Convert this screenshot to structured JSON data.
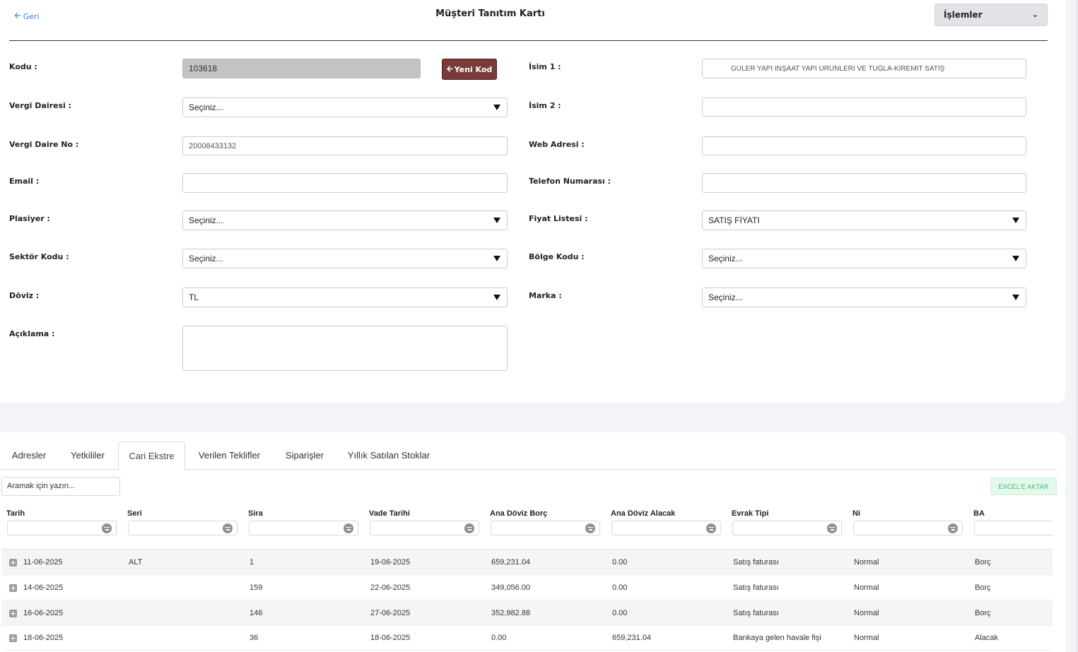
{
  "header": {
    "back_label": "Geri",
    "title": "Müşteri Tanıtım Kartı",
    "actions_label": "İşlemler"
  },
  "form": {
    "code_label": "Kodu :",
    "code_value": "103618",
    "new_code_label": "Yeni Kod",
    "tax_office_label": "Vergi Dairesi :",
    "tax_office_value": "Seçiniz...",
    "tax_no_label": "Vergi Daire No :",
    "tax_no_value": "20008433132",
    "email_label": "Email :",
    "email_value": "",
    "salesperson_label": "Plasiyer :",
    "salesperson_value": "Seçiniz...",
    "sector_label": "Sektör Kodu :",
    "sector_value": "Seçiniz...",
    "currency_label": "Döviz :",
    "currency_value": "TL",
    "description_label": "Açıklama :",
    "name1_label": "İsim 1 :",
    "name1_value": "GÜLER YAPI İNŞAAT YAPI ÜRÜNLERİ VE TUĞLA-KİREMİT SATIŞ",
    "name2_label": "İsim 2 :",
    "name2_value": "",
    "web_label": "Web Adresi :",
    "web_value": "",
    "phone_label": "Telefon Numarası :",
    "phone_value": "",
    "price_list_label": "Fiyat Listesi :",
    "price_list_value": "SATIŞ FİYATI",
    "region_label": "Bölge Kodu :",
    "region_value": "Seçiniz...",
    "brand_label": "Marka :",
    "brand_value": "Seçiniz..."
  },
  "tabs": [
    "Adresler",
    "Yetkililer",
    "Cari Ekstre",
    "Verilen Teklifler",
    "Siparişler",
    "Yıllık Satılan Stoklar"
  ],
  "active_tab": "Cari Ekstre",
  "grid": {
    "search_placeholder": "Aramak için yazın...",
    "excel_label": "EXCEL'E AKTAR",
    "columns": [
      "Tarih",
      "Seri",
      "Sira",
      "Vade Tarihi",
      "Ana Döviz Borç",
      "Ana Döviz Alacak",
      "Evrak Tipi",
      "Ni",
      "BA"
    ],
    "rows": [
      [
        "11-06-2025",
        "ALT",
        "1",
        "19-06-2025",
        "659,231.04",
        "0.00",
        "Satış faturası",
        "Normal",
        "Borç"
      ],
      [
        "14-06-2025",
        "",
        "159",
        "22-06-2025",
        "349,056.00",
        "0.00",
        "Satış faturası",
        "Normal",
        "Borç"
      ],
      [
        "16-06-2025",
        "",
        "146",
        "27-06-2025",
        "352,982.88",
        "0.00",
        "Satış faturası",
        "Normal",
        "Borç"
      ],
      [
        "18-06-2025",
        "",
        "36",
        "18-06-2025",
        "0.00",
        "659,231.04",
        "Bankaya gelen havale fişi",
        "Normal",
        "Alacak"
      ]
    ]
  }
}
